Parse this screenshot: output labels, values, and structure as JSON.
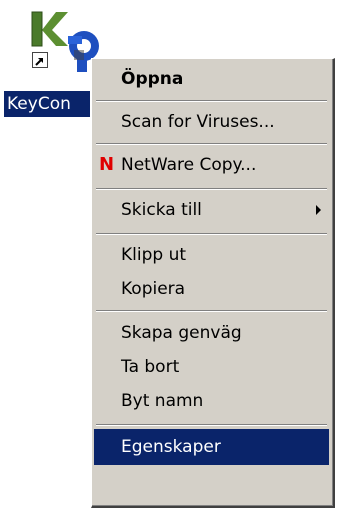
{
  "desktop_icon": {
    "label": "KeyCon"
  },
  "context_menu": {
    "items": [
      {
        "label": "Öppna"
      },
      {
        "label": "Scan for Viruses..."
      },
      {
        "label": "NetWare Copy...",
        "icon": "netware-n-icon",
        "icon_glyph": "N"
      },
      {
        "label": "Skicka till"
      },
      {
        "label": "Klipp ut"
      },
      {
        "label": "Kopiera"
      },
      {
        "label": "Skapa genväg"
      },
      {
        "label": "Ta bort"
      },
      {
        "label": "Byt namn"
      },
      {
        "label": "Egenskaper"
      }
    ]
  },
  "colors": {
    "menu_background": "#d4d0c8",
    "selection": "#0a246a",
    "netware_icon": "#e00000"
  }
}
